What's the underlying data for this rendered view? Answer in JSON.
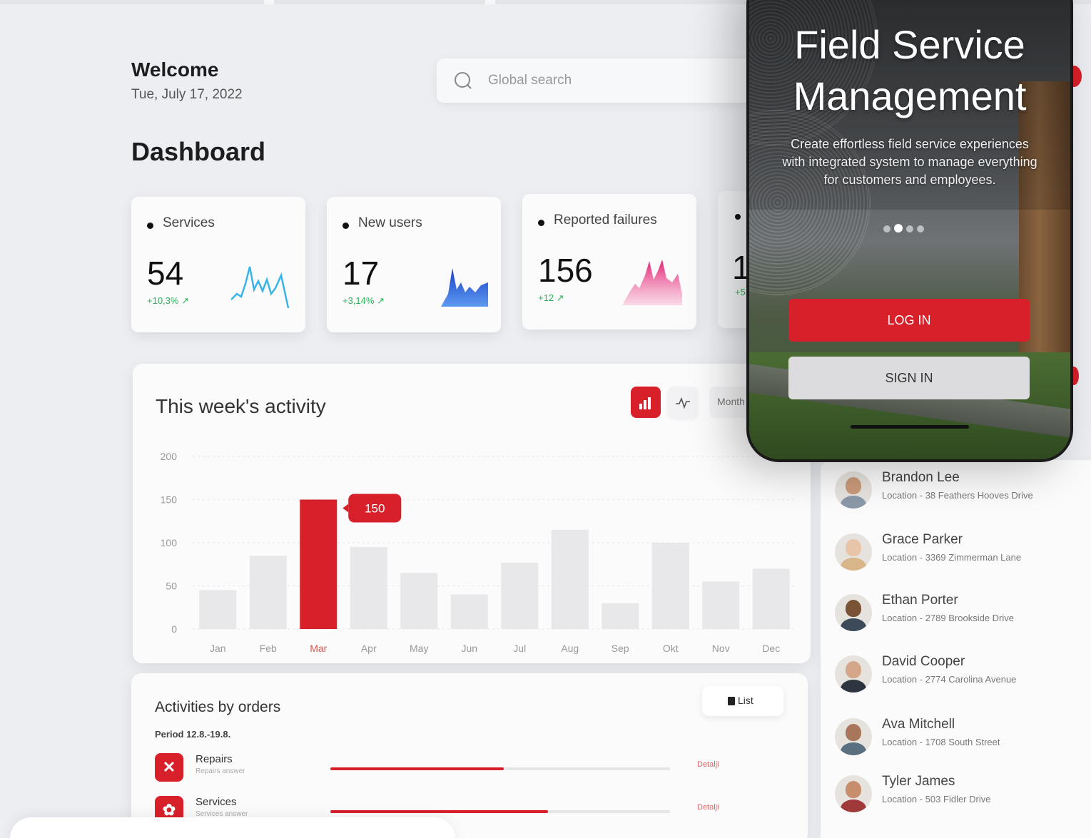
{
  "header": {
    "welcome": "Welcome",
    "date": "Tue, July 17, 2022",
    "title": "Dashboard",
    "search_placeholder": "Global search"
  },
  "stats": [
    {
      "label": "Services",
      "value": "54",
      "change": "+10,3%",
      "color": "#3ab4e6"
    },
    {
      "label": "New users",
      "value": "17",
      "change": "+3,14%",
      "color": "#1a5ad6"
    },
    {
      "label": "Reported failures",
      "value": "156",
      "change": "+12",
      "color": "#e23e8a"
    }
  ],
  "partial_stat": {
    "value": "1",
    "change": "+5"
  },
  "activity": {
    "title": "This week's activity",
    "controls": {
      "month": "Month"
    },
    "chart_data": {
      "type": "bar",
      "categories": [
        "Jan",
        "Feb",
        "Mar",
        "Apr",
        "May",
        "Jun",
        "Jul",
        "Aug",
        "Sep",
        "Okt",
        "Nov",
        "Dec"
      ],
      "values": [
        45,
        85,
        150,
        95,
        65,
        40,
        77,
        115,
        30,
        100,
        55,
        70
      ],
      "highlight": "Mar",
      "highlight_label": "150",
      "ylim": [
        0,
        200
      ],
      "yticks": [
        0,
        50,
        100,
        150,
        200
      ],
      "grid": true,
      "colors": {
        "bar": "#e8e8ea",
        "highlight": "#d8202a",
        "tooltip": "#d8202a"
      }
    }
  },
  "orders": {
    "title": "Activities by orders",
    "period": "Period 12.8.-19.8.",
    "list_label": "List",
    "rows": [
      {
        "name": "Repairs",
        "sub": "Repairs answer",
        "progress": 0.51,
        "detail": "Detalji",
        "icon": "tools-icon"
      },
      {
        "name": "Services",
        "sub": "Services answer",
        "progress": 0.64,
        "detail": "Detalji",
        "icon": "gear-icon"
      }
    ]
  },
  "people": [
    {
      "name": "Brandon Lee",
      "location": "Location - 38 Feathers Hooves Drive",
      "skin": "#c99a7a",
      "shirt": "#8b98a8"
    },
    {
      "name": "Grace Parker",
      "location": "Location - 3369 Zimmerman Lane",
      "skin": "#e8c4a8",
      "shirt": "#d9b58a"
    },
    {
      "name": "Ethan Porter",
      "location": "Location - 2789 Brookside Drive",
      "skin": "#7a5236",
      "shirt": "#3d4a5a"
    },
    {
      "name": "David Cooper",
      "location": "Location - 2774 Carolina Avenue",
      "skin": "#d4a78a",
      "shirt": "#2d3640"
    },
    {
      "name": "Ava Mitchell",
      "location": "Location - 1708 South Street",
      "skin": "#a8765a",
      "shirt": "#5a6f80"
    },
    {
      "name": "Tyler James",
      "location": "Location - 503 Fidler Drive",
      "skin": "#c68e6c",
      "shirt": "#a03a3a"
    }
  ],
  "phone": {
    "title_line1": "Field Service",
    "title_line2": "Management",
    "description": "Create effortless field service experiences with integrated system to manage everything for customers and employees.",
    "login": "LOG IN",
    "signin": "SIGN IN",
    "carousel_active": 2,
    "carousel_count": 4
  },
  "accent": "#d8202a"
}
